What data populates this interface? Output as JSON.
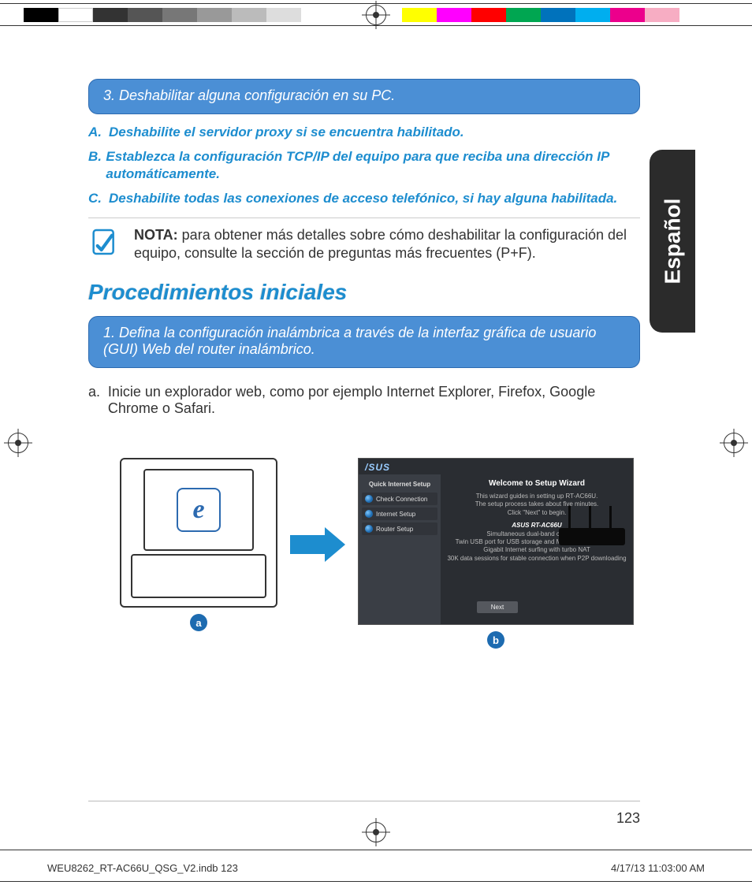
{
  "colorbar_left": [
    "#000000",
    "#ffffff",
    "#333333",
    "#555555",
    "#777777",
    "#999999",
    "#bbbbbb",
    "#dddddd"
  ],
  "colorbar_right": [
    "#ffff00",
    "#ff00ff",
    "#ff0000",
    "#00a651",
    "#0072bc",
    "#00aeef",
    "#92278f",
    "#f7941d"
  ],
  "language_tab": "Español",
  "step3_box": "3.  Deshabilitar alguna configuración en su PC.",
  "bullets": {
    "A": "Deshabilite el servidor proxy si se encuentra habilitado.",
    "B": "Establezca la configuración TCP/IP del equipo para que reciba una dirección IP automáticamente.",
    "C": "Deshabilite todas las conexiones de acceso telefónico, si hay alguna habilitada."
  },
  "note_label": "NOTA:",
  "note_text": "para obtener más detalles sobre cómo deshabilitar la configuración del equipo, consulte la sección de preguntas más frecuentes (P+F).",
  "section_heading": "Procedimientos iniciales",
  "step1_box": "1.  Defina la configuración inalámbrica a través de la interfaz gráfica de usuario (GUI) Web del router inalámbrico.",
  "body_a_label": "a.",
  "body_a_text": "Inicie un explorador web, como por ejemplo Internet Explorer, Firefox, Google Chrome o Safari.",
  "ie_glyph": "e",
  "wizard": {
    "brand": "/SUS",
    "sidebar_header": "Quick Internet Setup",
    "items": [
      "Check Connection",
      "Internet Setup",
      "Router Setup"
    ],
    "title": "Welcome to Setup Wizard",
    "line1": "This wizard guides in setting up RT-AC66U.",
    "line2": "The setup process takes about five minutes.",
    "line3": "Click \"Next\" to begin.",
    "model_heading": "ASUS RT-AC66U",
    "model_line1": "Simultaneous dual-band connection",
    "model_line2": "Twin USB port for USB storage and Multi-functional printer",
    "model_line3": "Gigabit Internet surfing with turbo NAT",
    "model_line4": "30K data sessions for stable connection when P2P downloading",
    "next": "Next"
  },
  "badge_a": "a",
  "badge_b": "b",
  "page_number": "123",
  "slug_left": "WEU8262_RT-AC66U_QSG_V2.indb   123",
  "slug_right": "4/17/13   11:03:00 AM"
}
